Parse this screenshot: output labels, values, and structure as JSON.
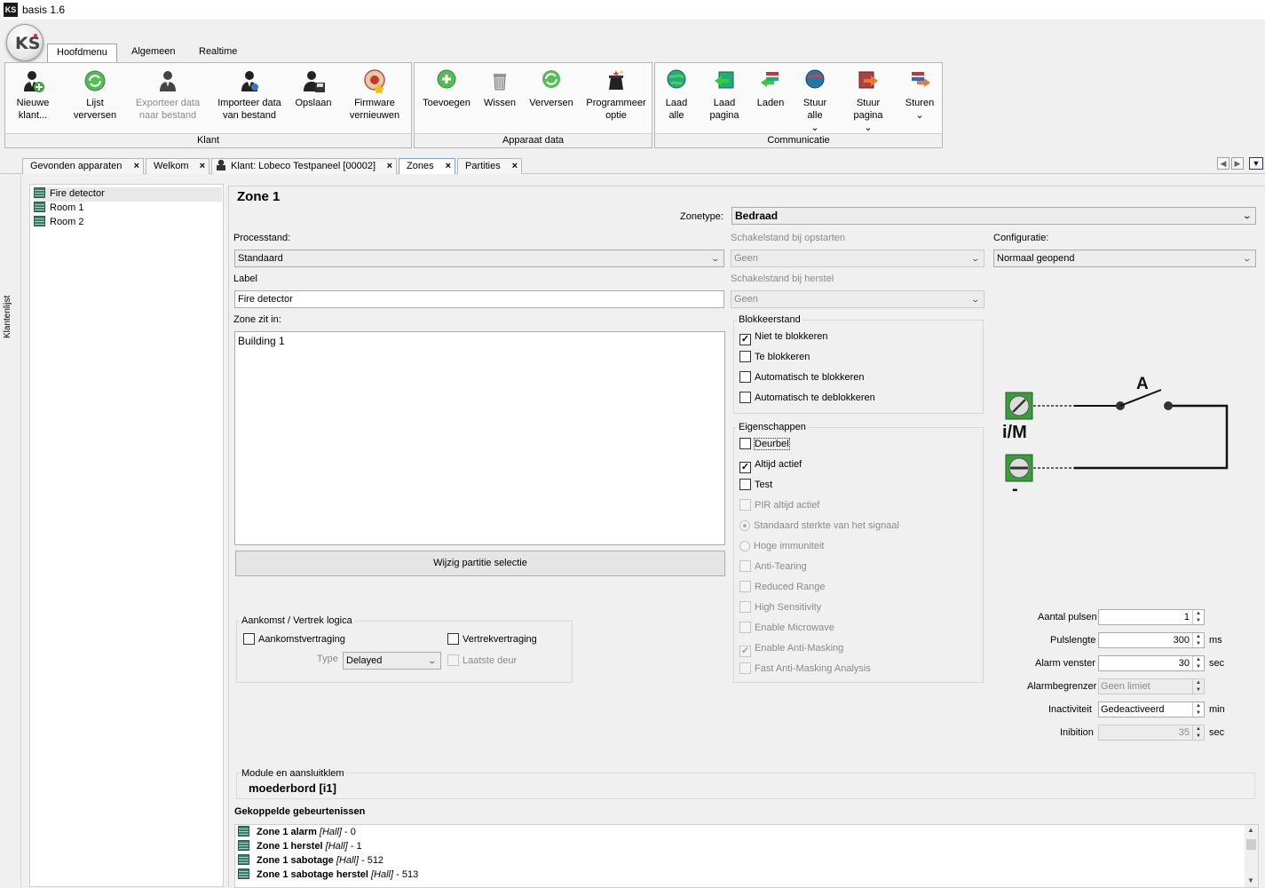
{
  "app": {
    "title": "basis 1.6",
    "logo": "KS"
  },
  "ribbon": {
    "tabs": [
      {
        "label": "Hoofdmenu"
      },
      {
        "label": "Algemeen"
      },
      {
        "label": "Realtime"
      }
    ],
    "groups": {
      "klant": {
        "caption": "Klant",
        "buttons": [
          {
            "label": "Nieuwe klant...",
            "icon": "new-client-icon"
          },
          {
            "label": "Lijst verversen",
            "icon": "refresh-icon"
          },
          {
            "label": "Exporteer data naar bestand",
            "icon": "export-icon",
            "disabled": true
          },
          {
            "label": "Importeer data van bestand",
            "icon": "import-icon"
          },
          {
            "label": "Opslaan",
            "icon": "save-icon"
          },
          {
            "label": "Firmware vernieuwen",
            "icon": "firmware-icon"
          }
        ]
      },
      "apparaat": {
        "caption": "Apparaat data",
        "buttons": [
          {
            "label": "Toevoegen",
            "icon": "add-icon"
          },
          {
            "label": "Wissen",
            "icon": "trash-icon"
          },
          {
            "label": "Verversen",
            "icon": "refresh-icon"
          },
          {
            "label": "Programmeer optie",
            "icon": "magic-icon"
          }
        ]
      },
      "communicatie": {
        "caption": "Communicatie",
        "buttons": [
          {
            "label": "Laad alle",
            "icon": "globe-icon"
          },
          {
            "label": "Laad pagina",
            "icon": "load-page-icon"
          },
          {
            "label": "Laden",
            "icon": "download-icon"
          },
          {
            "label": "Stuur alle",
            "icon": "globe-send-icon",
            "dropdown": true
          },
          {
            "label": "Stuur pagina",
            "icon": "send-page-icon",
            "dropdown": true
          },
          {
            "label": "Sturen",
            "icon": "send-icon",
            "dropdown": true
          }
        ]
      }
    }
  },
  "doc_tabs": [
    {
      "label": "Gevonden apparaten"
    },
    {
      "label": "Welkom"
    },
    {
      "label": "Klant: Lobeco Testpaneel [00002]"
    },
    {
      "label": "Zones"
    },
    {
      "label": "Partities"
    }
  ],
  "sidebar": {
    "label": "Klantenlijst"
  },
  "tree": {
    "items": [
      {
        "label": "Fire detector",
        "selected": true
      },
      {
        "label": "Room 1"
      },
      {
        "label": "Room 2"
      }
    ]
  },
  "zone": {
    "title": "Zone 1",
    "zonetype_label": "Zonetype:",
    "zonetype_value": "Bedraad",
    "processtand_label": "Processtand:",
    "processtand_value": "Standaard",
    "schakel_opstart_label": "Schakelstand bij opstarten",
    "schakel_opstart_value": "Geen",
    "configuratie_label": "Configuratie:",
    "configuratie_value": "Normaal geopend",
    "label_label": "Label",
    "label_value": "Fire detector",
    "schakel_herstel_label": "Schakelstand bij herstel",
    "schakel_herstel_value": "Geen",
    "zone_zit_in_label": "Zone zit in:",
    "zone_zit_in_value": "Building 1",
    "wijzig_button": "Wijzig partitie selectie",
    "blokkeer": {
      "legend": "Blokkeerstand",
      "options": [
        {
          "label": "Niet te blokkeren",
          "checked": true
        },
        {
          "label": "Te blokkeren",
          "checked": false
        },
        {
          "label": "Automatisch te blokkeren",
          "checked": false
        },
        {
          "label": "Automatisch te deblokkeren",
          "checked": false
        }
      ]
    },
    "eigenschappen": {
      "legend": "Eigenschappen",
      "options": [
        {
          "label": "Deurbel",
          "checked": false,
          "disabled": false,
          "kind": "check"
        },
        {
          "label": "Altijd actief",
          "checked": true,
          "disabled": false,
          "kind": "check"
        },
        {
          "label": "Test",
          "checked": false,
          "disabled": false,
          "kind": "check"
        },
        {
          "label": "PIR altijd actief",
          "checked": false,
          "disabled": true,
          "kind": "check"
        },
        {
          "label": "Standaard sterkte van het signaal",
          "checked": true,
          "disabled": true,
          "kind": "radio"
        },
        {
          "label": "Hoge immuniteit",
          "checked": false,
          "disabled": true,
          "kind": "radio"
        },
        {
          "label": "Anti-Tearing",
          "checked": false,
          "disabled": true,
          "kind": "check"
        },
        {
          "label": "Reduced Range",
          "checked": false,
          "disabled": true,
          "kind": "check"
        },
        {
          "label": "High Sensitivity",
          "checked": false,
          "disabled": true,
          "kind": "check"
        },
        {
          "label": "Enable Microwave",
          "checked": false,
          "disabled": true,
          "kind": "check"
        },
        {
          "label": "Enable Anti-Masking",
          "checked": true,
          "disabled": true,
          "kind": "check"
        },
        {
          "label": "Fast Anti-Masking Analysis",
          "checked": false,
          "disabled": true,
          "kind": "check"
        }
      ]
    },
    "aankomst": {
      "legend": "Aankomst / Vertrek logica",
      "aankomst_label": "Aankomstvertraging",
      "vertrek_label": "Vertrekvertraging",
      "type_label": "Type",
      "type_value": "Delayed",
      "laatste_label": "Laatste deur"
    },
    "diagram": {
      "switch_label": "A",
      "terminal_top": "i/M",
      "terminal_bottom": "-"
    },
    "params": [
      {
        "label": "Aantal pulsen",
        "value": "1",
        "unit": "",
        "disabled": false
      },
      {
        "label": "Pulslengte",
        "value": "300",
        "unit": "ms",
        "disabled": false
      },
      {
        "label": "Alarm venster",
        "value": "30",
        "unit": "sec",
        "disabled": false
      },
      {
        "label": "Alarmbegrenzer",
        "value": "Geen limiet",
        "unit": "",
        "disabled": true
      },
      {
        "label": "Inactiviteit",
        "value": "Gedeactiveerd",
        "unit": "min",
        "disabled": false
      },
      {
        "label": "Inibition",
        "value": "35",
        "unit": "sec",
        "disabled": true
      }
    ],
    "module_label": "Module en aansluitklem",
    "module_value": "moederbord [i1]",
    "events_title": "Gekoppelde gebeurtenissen",
    "events": [
      {
        "name": "Zone 1 alarm",
        "area": "[Hall]",
        "code": " - 0"
      },
      {
        "name": "Zone 1 herstel",
        "area": "[Hall]",
        "code": " - 1"
      },
      {
        "name": "Zone 1 sabotage",
        "area": "[Hall]",
        "code": " - 512"
      },
      {
        "name": "Zone 1 sabotage herstel",
        "area": "[Hall]",
        "code": " - 513"
      }
    ]
  }
}
